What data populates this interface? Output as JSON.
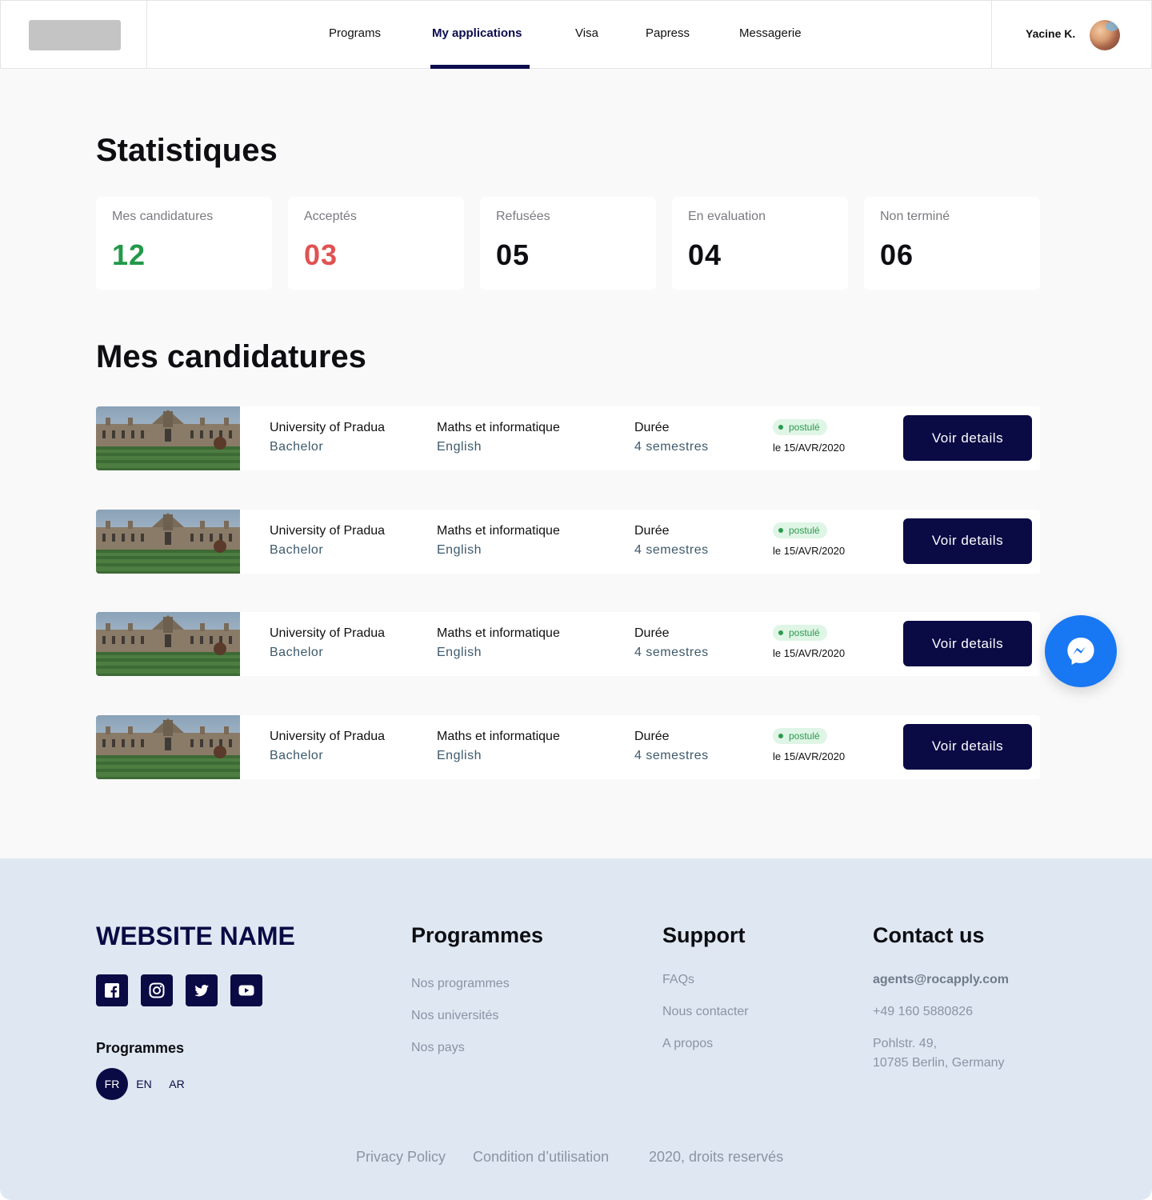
{
  "header": {
    "nav": [
      {
        "label": "Programs",
        "active": false
      },
      {
        "label": "My applications",
        "active": true
      },
      {
        "label": "Visa",
        "active": false
      },
      {
        "label": "Papress",
        "active": false
      },
      {
        "label": "Messagerie",
        "active": false
      }
    ],
    "user_name": "Yacine K."
  },
  "stats": {
    "title": "Statistiques",
    "cards": [
      {
        "label": "Mes candidatures",
        "value": "12",
        "color": "#22994a"
      },
      {
        "label": "Acceptés",
        "value": "03",
        "color": "#e05252"
      },
      {
        "label": "Refusées",
        "value": "05",
        "color": "#0d0d12"
      },
      {
        "label": "En evaluation",
        "value": "04",
        "color": "#0d0d12"
      },
      {
        "label": "Non terminé",
        "value": "06",
        "color": "#0d0d12"
      }
    ]
  },
  "applications": {
    "title": "Mes candidatures",
    "items": [
      {
        "university": "University of Pradua",
        "degree": "Bachelor",
        "program": "Maths et informatique",
        "language": "English",
        "duration_label": "Durée",
        "duration": "4 semestres",
        "status": "postulé",
        "date": "le 15/AVR/2020",
        "button": "Voir details"
      },
      {
        "university": "University of Pradua",
        "degree": "Bachelor",
        "program": "Maths et informatique",
        "language": "English",
        "duration_label": "Durée",
        "duration": "4 semestres",
        "status": "postulé",
        "date": "le 15/AVR/2020",
        "button": "Voir details"
      },
      {
        "university": "University of Pradua",
        "degree": "Bachelor",
        "program": "Maths et informatique",
        "language": "English",
        "duration_label": "Durée",
        "duration": "4 semestres",
        "status": "postulé",
        "date": "le 15/AVR/2020",
        "button": "Voir details"
      },
      {
        "university": "University of Pradua",
        "degree": "Bachelor",
        "program": "Maths et informatique",
        "language": "English",
        "duration_label": "Durée",
        "duration": "4 semestres",
        "status": "postulé",
        "date": "le 15/AVR/2020",
        "button": "Voir details"
      }
    ]
  },
  "messenger_icon": "messenger-icon",
  "footer": {
    "brand": "WEBSITE NAME",
    "social_icons": [
      "facebook-icon",
      "instagram-icon",
      "twitter-icon",
      "youtube-icon"
    ],
    "programmes_label": "Programmes",
    "languages": [
      {
        "label": "FR",
        "active": true
      },
      {
        "label": "EN",
        "active": false
      },
      {
        "label": "AR",
        "active": false
      }
    ],
    "columns": {
      "programmes": {
        "title": "Programmes",
        "links": [
          "Nos programmes",
          "Nos universités",
          "Nos pays"
        ]
      },
      "support": {
        "title": "Support",
        "links": [
          "FAQs",
          "Nous contacter",
          "A propos"
        ]
      },
      "contact": {
        "title": "Contact us",
        "email": "agents@rocapply.com",
        "phone": "+49 160 5880826",
        "address_line1": "Pohlstr. 49,",
        "address_line2": "10785 Berlin, Germany"
      }
    },
    "bottom_links": [
      "Privacy Policy",
      "Condition d’utilisation",
      "2020, droits reservés"
    ]
  },
  "colors": {
    "primary": "#0a0a45",
    "accepted": "#e05252",
    "total": "#22994a",
    "status_badge_bg": "#dff5e6",
    "footer_bg": "#dfe8f2",
    "messenger": "#1877f2"
  }
}
